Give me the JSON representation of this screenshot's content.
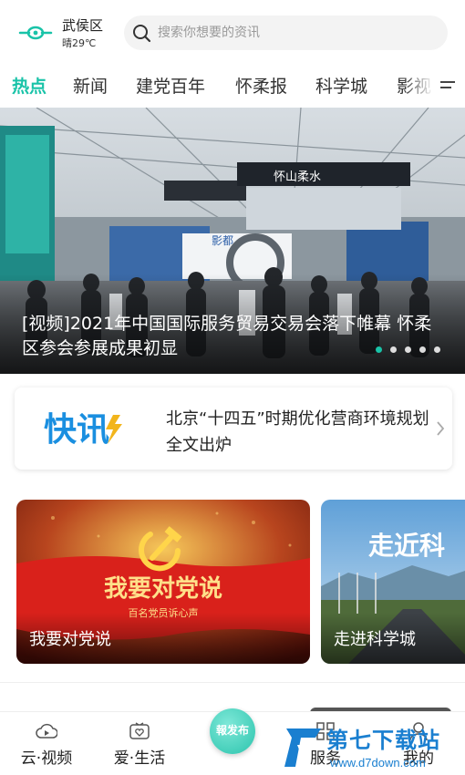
{
  "header": {
    "location": "武侯区",
    "weather": "晴29℃",
    "search_placeholder": "搜索你想要的资讯"
  },
  "tabs": [
    {
      "label": "热点",
      "active": true
    },
    {
      "label": "新闻",
      "active": false
    },
    {
      "label": "建党百年",
      "active": false
    },
    {
      "label": "怀柔报",
      "active": false
    },
    {
      "label": "科学城",
      "active": false
    },
    {
      "label": "影视",
      "active": false
    }
  ],
  "hero": {
    "caption": "[视频]2021年中国国际服务贸易交易会落下帷幕 怀柔区参会参展成果初显",
    "slide_count": 5,
    "active_slide": 1,
    "booth_sign_1": "怀山柔水",
    "booth_sign_2": "影都"
  },
  "flash": {
    "logo_text": "快讯",
    "headline": "北京“十四五”时期优化营商环境规划全文出炉"
  },
  "cards": [
    {
      "title": "我要对党说",
      "banner_text": "我要对党说",
      "banner_sub": "百名党员诉心声"
    },
    {
      "title": "走进科学城",
      "banner_text": "走近科"
    }
  ],
  "bottom_nav": [
    {
      "label": "云·视频",
      "icon": "cloud-video-icon"
    },
    {
      "label": "爱·生活",
      "icon": "tv-heart-icon"
    },
    {
      "label": "服务",
      "icon": "grid-service-icon"
    },
    {
      "label": "我的",
      "icon": "user-icon"
    }
  ],
  "publish_button": {
    "label": "報发布"
  },
  "watermark": {
    "name": "第七下载站",
    "url": "www.d7down.com"
  },
  "colors": {
    "accent": "#19c3a8",
    "flash_blue": "#1a8fe0",
    "flash_yellow": "#f2b51c",
    "party_red": "#d9211b"
  }
}
